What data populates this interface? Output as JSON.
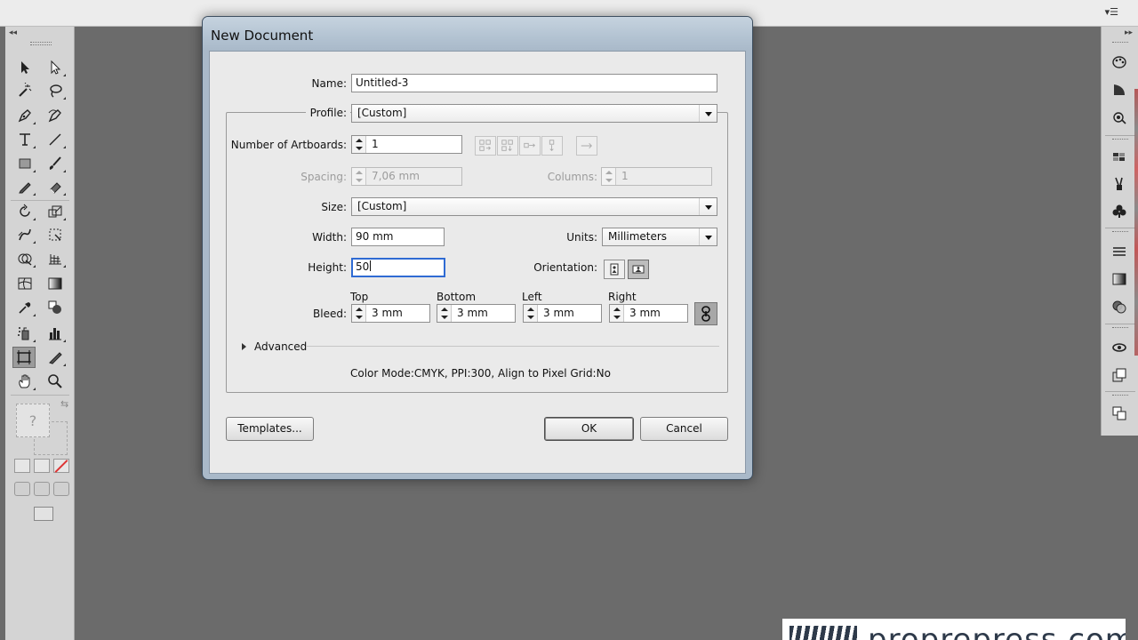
{
  "dialog": {
    "title": "New Document",
    "name_label": "Name:",
    "name_value": "Untitled-3",
    "profile_label": "Profile:",
    "profile_value": "[Custom]",
    "artboards_label": "Number of Artboards:",
    "artboards_value": "1",
    "spacing_label": "Spacing:",
    "spacing_value": "7,06 mm",
    "columns_label": "Columns:",
    "columns_value": "1",
    "size_label": "Size:",
    "size_value": "[Custom]",
    "width_label": "Width:",
    "width_value": "90 mm",
    "units_label": "Units:",
    "units_value": "Millimeters",
    "height_label": "Height:",
    "height_value": "50",
    "orientation_label": "Orientation:",
    "bleed_label": "Bleed:",
    "bleed": {
      "top_label": "Top",
      "top_value": "3 mm",
      "bottom_label": "Bottom",
      "bottom_value": "3 mm",
      "left_label": "Left",
      "left_value": "3 mm",
      "right_label": "Right",
      "right_value": "3 mm"
    },
    "advanced_label": "Advanced",
    "summary": "Color Mode:CMYK, PPI:300, Align to Pixel Grid:No",
    "templates_button": "Templates...",
    "ok_button": "OK",
    "cancel_button": "Cancel"
  },
  "artboard_layout_icons": [
    "grid-by-row-icon",
    "grid-by-column-icon",
    "arrange-by-row-icon",
    "arrange-by-column-icon",
    "right-to-left-icon"
  ],
  "toolbar_icons": [
    "selection-tool-icon",
    "direct-selection-tool-icon",
    "magic-wand-tool-icon",
    "lasso-tool-icon",
    "pen-tool-icon",
    "curvature-tool-icon",
    "type-tool-icon",
    "line-segment-tool-icon",
    "rectangle-tool-icon",
    "paintbrush-tool-icon",
    "pencil-tool-icon",
    "eraser-tool-icon",
    "rotate-tool-icon",
    "scale-tool-icon",
    "warp-tool-icon",
    "free-transform-tool-icon",
    "shape-builder-tool-icon",
    "perspective-grid-tool-icon",
    "mesh-tool-icon",
    "gradient-tool-icon",
    "eyedropper-tool-icon",
    "blend-tool-icon",
    "symbol-sprayer-tool-icon",
    "column-graph-tool-icon",
    "artboard-tool-icon",
    "slice-tool-icon",
    "hand-tool-icon",
    "zoom-tool-icon"
  ],
  "panel_icons": [
    "color-panel-icon",
    "color-guide-panel-icon",
    "kuler-panel-icon",
    "swatches-panel-icon",
    "brushes-panel-icon",
    "symbols-panel-icon",
    "stroke-panel-icon",
    "gradient-panel-icon",
    "transparency-panel-icon",
    "appearance-panel-icon",
    "graphic-styles-panel-icon",
    "layers-panel-icon",
    "artboards-panel-icon"
  ],
  "colors": {
    "workspace": "#6b6b6b",
    "dialog_frame": "#a9b9c9",
    "dialog_body": "#eaeaea",
    "focus_ring": "#2f6bd3",
    "watermark_ink": "#2e3a4a"
  },
  "watermark": {
    "text": "proprepress.com"
  }
}
